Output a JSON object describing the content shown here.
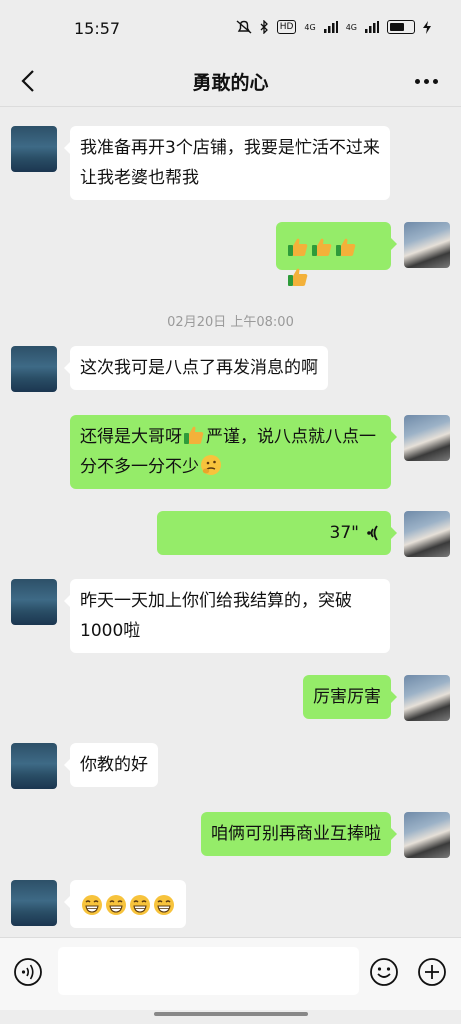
{
  "status_bar": {
    "time": "15:57",
    "hd_label": "HD",
    "signal_1": "4G",
    "signal_2": "4G"
  },
  "header": {
    "title": "勇敢的心"
  },
  "messages": [
    {
      "side": "left",
      "text": "我准备再开3个店铺，我要是忙活不过来 让我老婆也帮我"
    },
    {
      "side": "right",
      "emoji": [
        "thumbs-up",
        "thumbs-up",
        "thumbs-up",
        "thumbs-up"
      ]
    },
    {
      "timestamp": "02月20日 上午08:00"
    },
    {
      "side": "left",
      "text": "这次我可是八点了再发消息的啊"
    },
    {
      "side": "right",
      "text_a": "还得是大哥呀",
      "text_b": "严谨，说八点就八点一分不多一分不少",
      "emoji": [
        "thumbs-up",
        "thinking-face"
      ]
    },
    {
      "side": "right",
      "voice_duration": "37\""
    },
    {
      "side": "left",
      "text": "昨天一天加上你们给我结算的，突破1000啦"
    },
    {
      "side": "right",
      "text": "厉害厉害"
    },
    {
      "side": "left",
      "text": "你教的好"
    },
    {
      "side": "right",
      "text": "咱俩可别再商业互捧啦"
    },
    {
      "side": "left",
      "emoji": [
        "grinning-face",
        "grinning-face",
        "grinning-face",
        "grinning-face"
      ]
    }
  ],
  "input": {
    "placeholder": ""
  },
  "colors": {
    "background": "#ededed",
    "my_bubble": "#95ec69",
    "their_bubble": "#ffffff"
  }
}
